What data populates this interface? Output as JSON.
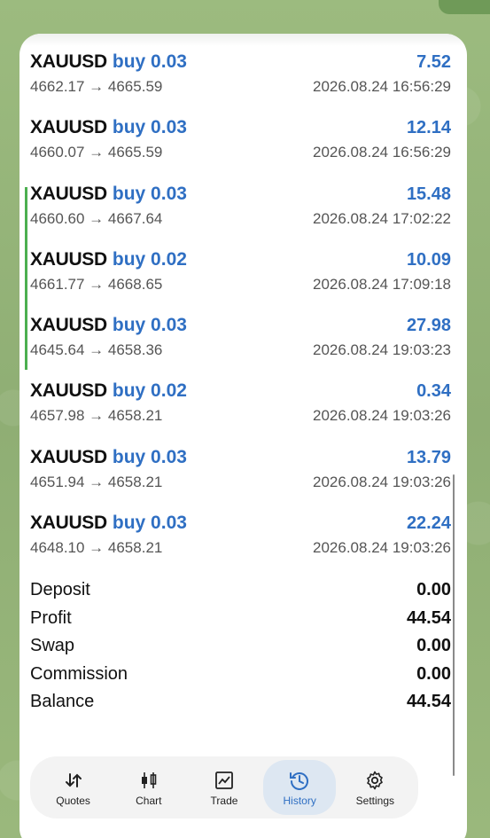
{
  "deals": [
    {
      "symbol": "XAUUSD",
      "side": "buy 0.03",
      "profit": "7.52",
      "prices": "4662.17 → 4665.59",
      "time": "2026.08.24 16:56:29"
    },
    {
      "symbol": "XAUUSD",
      "side": "buy 0.03",
      "profit": "12.14",
      "prices": "4660.07 → 4665.59",
      "time": "2026.08.24 16:56:29"
    },
    {
      "symbol": "XAUUSD",
      "side": "buy 0.03",
      "profit": "15.48",
      "prices": "4660.60 → 4667.64",
      "time": "2026.08.24 17:02:22"
    },
    {
      "symbol": "XAUUSD",
      "side": "buy 0.02",
      "profit": "10.09",
      "prices": "4661.77 → 4668.65",
      "time": "2026.08.24 17:09:18"
    },
    {
      "symbol": "XAUUSD",
      "side": "buy 0.03",
      "profit": "27.98",
      "prices": "4645.64 → 4658.36",
      "time": "2026.08.24 19:03:23"
    },
    {
      "symbol": "XAUUSD",
      "side": "buy 0.02",
      "profit": "0.34",
      "prices": "4657.98 → 4658.21",
      "time": "2026.08.24 19:03:26"
    },
    {
      "symbol": "XAUUSD",
      "side": "buy 0.03",
      "profit": "13.79",
      "prices": "4651.94 → 4658.21",
      "time": "2026.08.24 19:03:26"
    },
    {
      "symbol": "XAUUSD",
      "side": "buy 0.03",
      "profit": "22.24",
      "prices": "4648.10 → 4658.21",
      "time": "2026.08.24 19:03:26"
    }
  ],
  "summary": {
    "deposit": {
      "label": "Deposit",
      "value": "0.00"
    },
    "profit": {
      "label": "Profit",
      "value": "44.54"
    },
    "swap": {
      "label": "Swap",
      "value": "0.00"
    },
    "commission": {
      "label": "Commission",
      "value": "0.00"
    },
    "balance": {
      "label": "Balance",
      "value": "44.54"
    }
  },
  "nav": {
    "quotes": "Quotes",
    "chart": "Chart",
    "trade": "Trade",
    "history": "History",
    "settings": "Settings",
    "active": "history"
  },
  "colors": {
    "accent": "#2f6fc3",
    "marker": "#4caf50",
    "wallpaper": "#93b277"
  }
}
